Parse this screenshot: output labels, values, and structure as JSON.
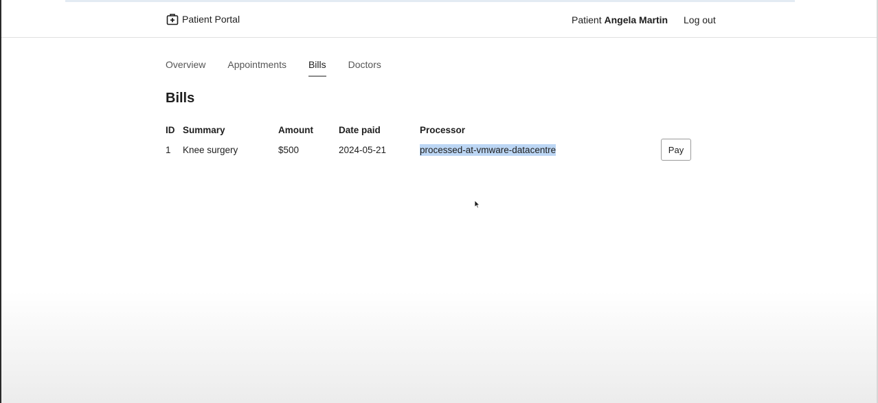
{
  "header": {
    "brand_label": "Patient Portal",
    "brand_icon": "medical-kit-icon",
    "user_prefix": "Patient",
    "user_name": "Angela Martin",
    "logout_label": "Log out"
  },
  "tabs": [
    {
      "label": "Overview",
      "active": false
    },
    {
      "label": "Appointments",
      "active": false
    },
    {
      "label": "Bills",
      "active": true
    },
    {
      "label": "Doctors",
      "active": false
    }
  ],
  "main": {
    "title": "Bills",
    "columns": [
      "ID",
      "Summary",
      "Amount",
      "Date paid",
      "Processor"
    ],
    "rows": [
      {
        "id": "1",
        "summary": "Knee surgery",
        "amount": "$500",
        "date_paid": "2024-05-21",
        "processor": "processed-at-vmware-datacentre",
        "action_label": "Pay"
      }
    ]
  },
  "colors": {
    "selection": "#bcd6f4",
    "text": "#1d1d1d",
    "tab_underline": "#8a8a8a"
  }
}
